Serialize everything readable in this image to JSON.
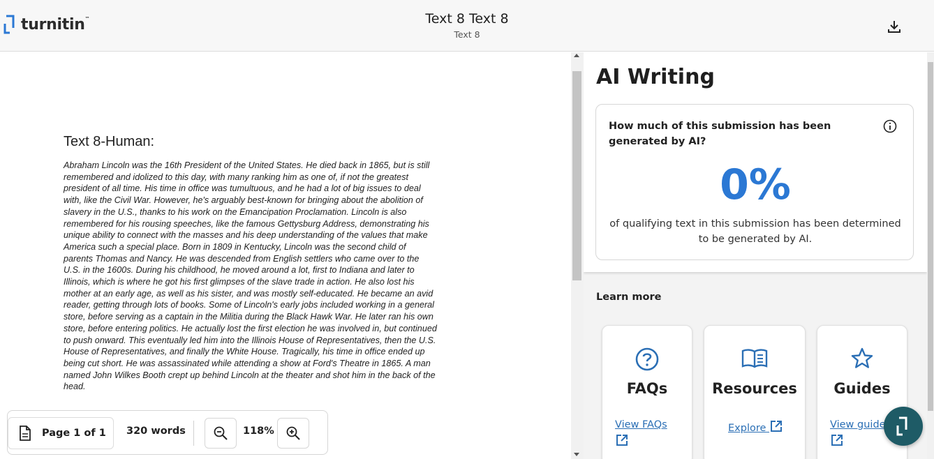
{
  "header": {
    "logo_text": "turnitin",
    "logo_tm": "™",
    "title": "Text 8 Text 8",
    "subtitle": "Text 8",
    "download_icon": "download-icon"
  },
  "document": {
    "heading": "Text 8-Human:",
    "lines": [
      "Abraham Lincoln was the 16th President of the United States. He died back in 1865, but is still",
      "remembered and idolized to this day, with many ranking him as one of, if not the greatest",
      "president of all time. His time in office was tumultuous, and he had a lot of big issues to deal",
      "with, like the Civil War. However, he's arguably best-known for bringing about the abolition of",
      "slavery in the U.S., thanks to his work on the Emancipation Proclamation. Lincoln is also",
      "remembered for his rousing speeches, like the famous Gettysburg Address, demonstrating his",
      "unique ability to connect with the masses and his deep understanding of the values that make",
      "America such a special place. Born in 1809 in Kentucky, Lincoln was the second child of",
      "parents Thomas and Nancy. He was descended from English settlers who came over to the",
      "U.S. in the 1600s. During his childhood, he moved around a lot, first to Indiana and later to",
      "Illinois, which is where he got his first glimpses of the slave trade in action. He also lost his",
      "mother at an early age, as well as his sister, and was mostly self-educated. He became an avid",
      "reader, getting through lots of books. Some of Lincoln's early jobs included working in a general",
      "store, before serving as a captain in the Militia during the Black Hawk War. He later ran his own",
      "store, before entering politics. He actually lost the first election he was involved in, but continued",
      "to push onward. This eventually led him into the Illinois House of Representatives, then the U.S.",
      "House of Representatives, and finally the White House. Tragically, his time in office ended up",
      "being cut short. He was assassinated while attending a show at Ford's Theatre in 1865. A man",
      "named John Wilkes Booth crept up behind Lincoln at the theater and shot him in the back of the",
      "head."
    ]
  },
  "toolbar": {
    "page_label": "Page 1 of 1",
    "word_count": "320 words",
    "zoom_level": "118%"
  },
  "ai_panel": {
    "title": "AI Writing",
    "question": "How much of this submission has been generated by AI?",
    "percent": "0%",
    "description": "of qualifying text in this submission has been determined to be generated by AI.",
    "accent_color": "#2b78d4"
  },
  "learn_more": {
    "label": "Learn more",
    "cards": [
      {
        "title": "FAQs",
        "link": "View FAQs",
        "icon": "question-circle-icon"
      },
      {
        "title": "Resources",
        "link": "Explore",
        "icon": "book-icon"
      },
      {
        "title": "Guides",
        "link": "View guides",
        "icon": "star-icon"
      }
    ]
  }
}
